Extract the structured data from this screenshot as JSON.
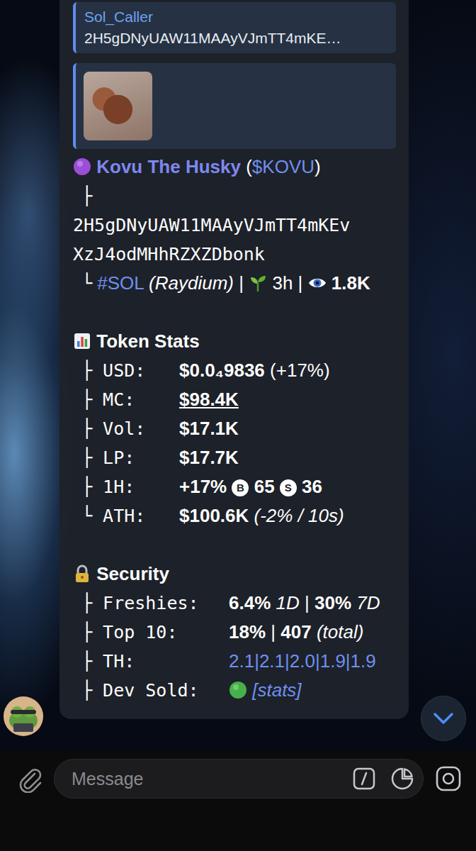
{
  "reply": {
    "author": "Sol_Caller",
    "text": "2H5gDNyUAW11MAAyVJmTT4mKE…"
  },
  "header": {
    "name": "Kovu The Husky",
    "open": "(",
    "ticker": "$KOVU",
    "close": ")"
  },
  "branch": "├",
  "address": [
    "2H5gDNyUAW11MAAyVJmTT4mKEv",
    "XzJ4odMHhRZXZDbonk"
  ],
  "chain": {
    "branch": "└",
    "chain": "#SOL",
    "dex": "(Raydium)",
    "sep1": "|",
    "age": "3h",
    "sep2": "|",
    "views": "1.8K"
  },
  "sections": [
    {
      "title": "Token Stats",
      "kind": "stats",
      "rows": [
        {
          "label": "├ USD:",
          "parts": [
            {
              "text": "$0.0₄9836",
              "kind": "bold"
            },
            {
              "text": "(+17%)",
              "kind": "plain"
            }
          ]
        },
        {
          "label": "├ MC:",
          "parts": [
            {
              "text": "$98.4K",
              "kind": "underline"
            }
          ]
        },
        {
          "label": "├ Vol:",
          "parts": [
            {
              "text": "$17.1K",
              "kind": "bold"
            }
          ]
        },
        {
          "label": "├ LP:",
          "parts": [
            {
              "text": "$17.7K",
              "kind": "bold"
            }
          ]
        },
        {
          "label": "├ 1H:",
          "parts": [
            {
              "text": "+17%",
              "kind": "bold"
            },
            {
              "text": "B",
              "kind": "badge"
            },
            {
              "text": "65",
              "kind": "bold"
            },
            {
              "text": "S",
              "kind": "badge"
            },
            {
              "text": "36",
              "kind": "bold"
            }
          ]
        },
        {
          "label": "└ ATH:",
          "parts": [
            {
              "text": "$100.6K",
              "kind": "bold"
            },
            {
              "text": "(-2% / 10s)",
              "kind": "italic"
            }
          ]
        }
      ]
    },
    {
      "title": "Security",
      "kind": "security",
      "rows": [
        {
          "label": "├ Freshies:",
          "parts": [
            {
              "text": "6.4%",
              "kind": "bold"
            },
            {
              "text": "1D",
              "kind": "italic"
            },
            {
              "text": "|",
              "kind": "plain"
            },
            {
              "text": "30%",
              "kind": "bold"
            },
            {
              "text": "7D",
              "kind": "italic"
            }
          ]
        },
        {
          "label": "├ Top 10:",
          "parts": [
            {
              "text": "18%",
              "kind": "bold"
            },
            {
              "text": "|",
              "kind": "plain"
            },
            {
              "text": "407",
              "kind": "bold"
            },
            {
              "text": "(total)",
              "kind": "italic"
            }
          ]
        },
        {
          "label": "├ TH:",
          "parts": [
            {
              "text": "2.1|2.1|2.0|1.9|1.9",
              "kind": "link"
            }
          ]
        },
        {
          "label": "├ Dev Sold:",
          "parts": [
            {
              "text": "",
              "kind": "dot"
            },
            {
              "text": "[stats]",
              "kind": "link-italic"
            }
          ]
        }
      ]
    }
  ],
  "composer": {
    "placeholder": "Message"
  }
}
